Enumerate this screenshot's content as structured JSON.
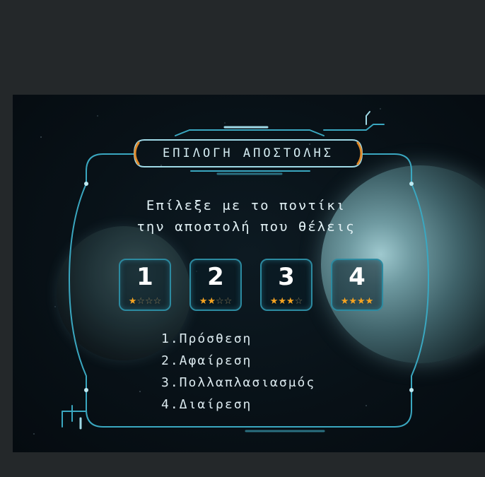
{
  "title": "ΕΠΙΛΟΓΗ ΑΠΟΣΤΟΛΗΣ",
  "prompt": {
    "line1": "Επίλεξε με το ποντίκι",
    "line2": "την αποστολή που θέλεις"
  },
  "levels": [
    {
      "number": "1",
      "stars_filled": 1,
      "stars_total": 4
    },
    {
      "number": "2",
      "stars_filled": 2,
      "stars_total": 4
    },
    {
      "number": "3",
      "stars_filled": 3,
      "stars_total": 4
    },
    {
      "number": "4",
      "stars_filled": 4,
      "stars_total": 4
    }
  ],
  "missions": [
    "1.Πρόσθεση",
    "2.Αφαίρεση",
    "3.Πολλαπλασιασμός",
    "4.Διαίρεση"
  ],
  "colors": {
    "frame": "#3aa7c0",
    "star_filled": "#f5a321",
    "star_empty": "#8a7a55",
    "text": "#e2f1f5"
  }
}
